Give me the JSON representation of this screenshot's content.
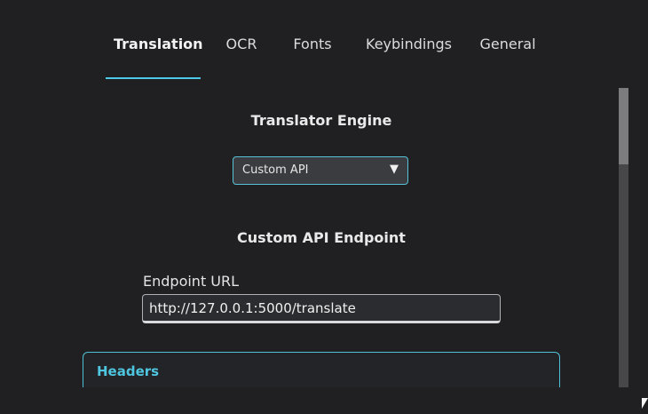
{
  "tabs": [
    {
      "label": "Translation",
      "active": true
    },
    {
      "label": "OCR",
      "active": false
    },
    {
      "label": "Fonts",
      "active": false
    },
    {
      "label": "Keybindings",
      "active": false
    },
    {
      "label": "General",
      "active": false
    }
  ],
  "translator": {
    "heading": "Translator Engine",
    "selected": "Custom API",
    "dropdown_icon": "triangle-down-icon"
  },
  "custom_api": {
    "heading": "Custom API Endpoint",
    "endpoint_label": "Endpoint URL",
    "endpoint_value": "http://127.0.0.1:5000/translate"
  },
  "headers": {
    "title": "Headers"
  },
  "colors": {
    "background": "#202022",
    "accent": "#4cc9e6",
    "input_bg": "#2b2c2f"
  }
}
